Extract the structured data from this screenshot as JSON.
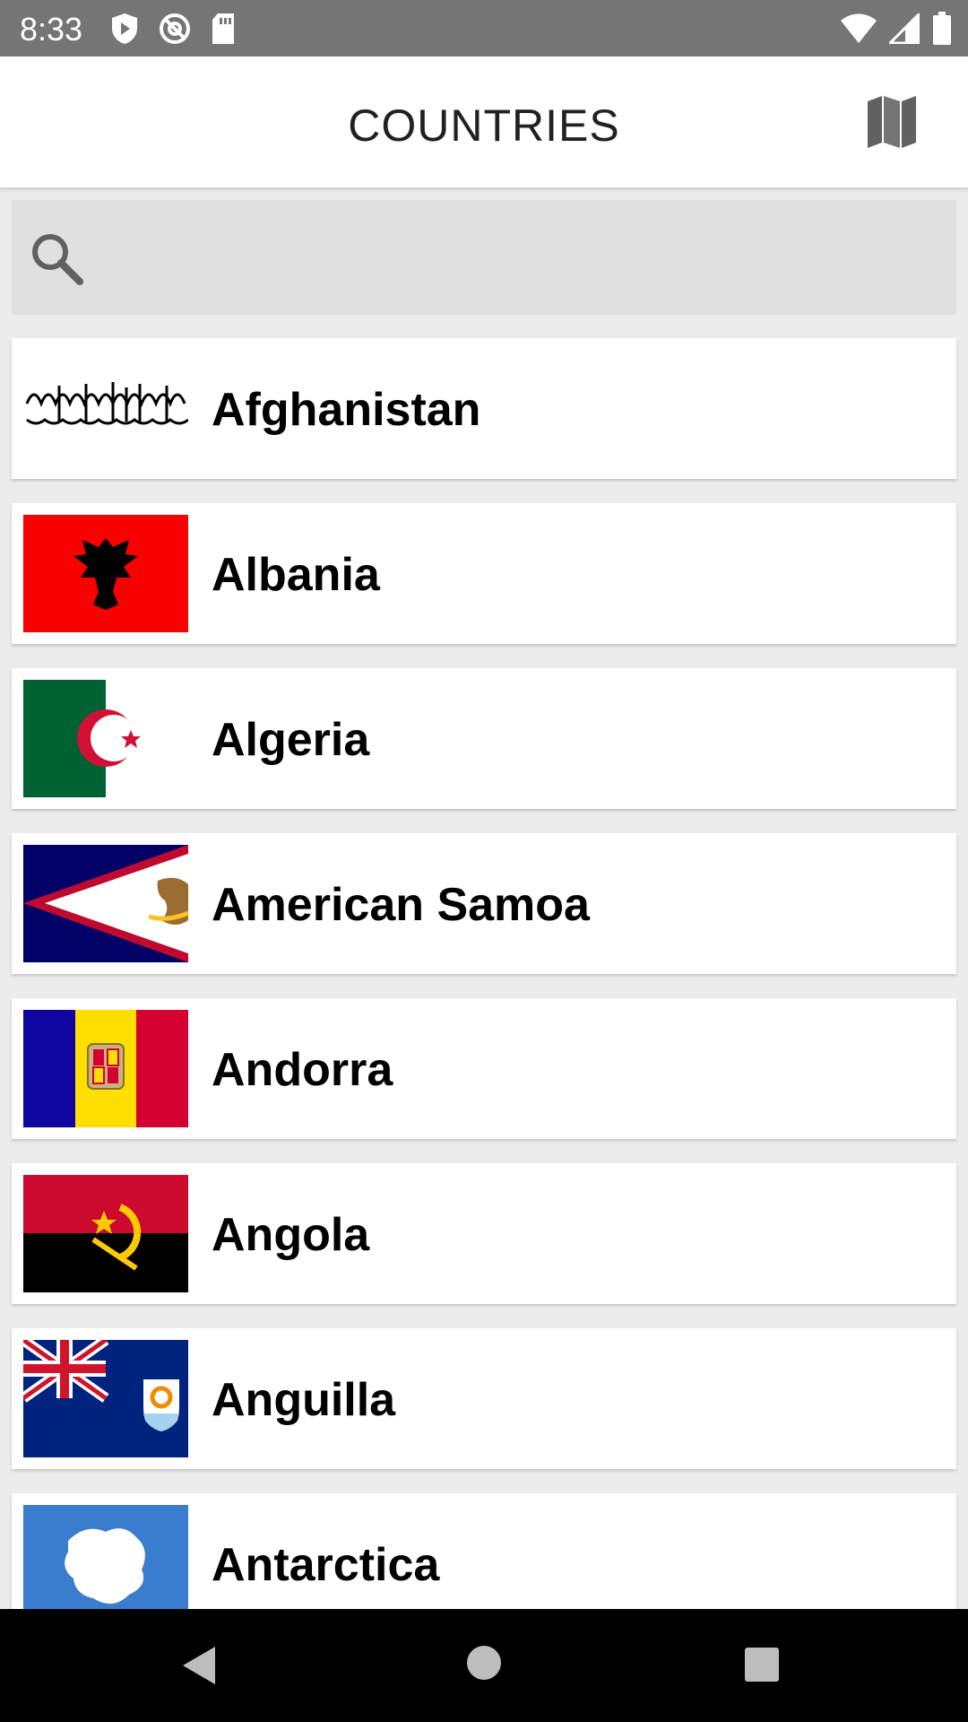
{
  "status_bar": {
    "time": "8:33",
    "icons": [
      "shield-play-icon",
      "at-sync-icon",
      "sd-card-icon",
      "wifi-icon",
      "cell-signal-icon",
      "battery-icon"
    ]
  },
  "app_bar": {
    "title": "COUNTRIES",
    "map_icon": "map-icon"
  },
  "search": {
    "icon": "search-icon",
    "value": "",
    "placeholder": ""
  },
  "countries": [
    {
      "name": "Afghanistan",
      "flag": "afghanistan-flag"
    },
    {
      "name": "Albania",
      "flag": "albania-flag"
    },
    {
      "name": "Algeria",
      "flag": "algeria-flag"
    },
    {
      "name": "American Samoa",
      "flag": "american-samoa-flag"
    },
    {
      "name": "Andorra",
      "flag": "andorra-flag"
    },
    {
      "name": "Angola",
      "flag": "angola-flag"
    },
    {
      "name": "Anguilla",
      "flag": "anguilla-flag"
    },
    {
      "name": "Antarctica",
      "flag": "antarctica-flag"
    }
  ],
  "nav_bar": {
    "icons": [
      "back-icon",
      "home-icon",
      "recents-icon"
    ]
  },
  "colors": {
    "status_bar": "#757575",
    "app_bar": "#ffffff",
    "background": "#ececec",
    "search_bg": "#e0e0e0",
    "nav_bar": "#000000"
  }
}
